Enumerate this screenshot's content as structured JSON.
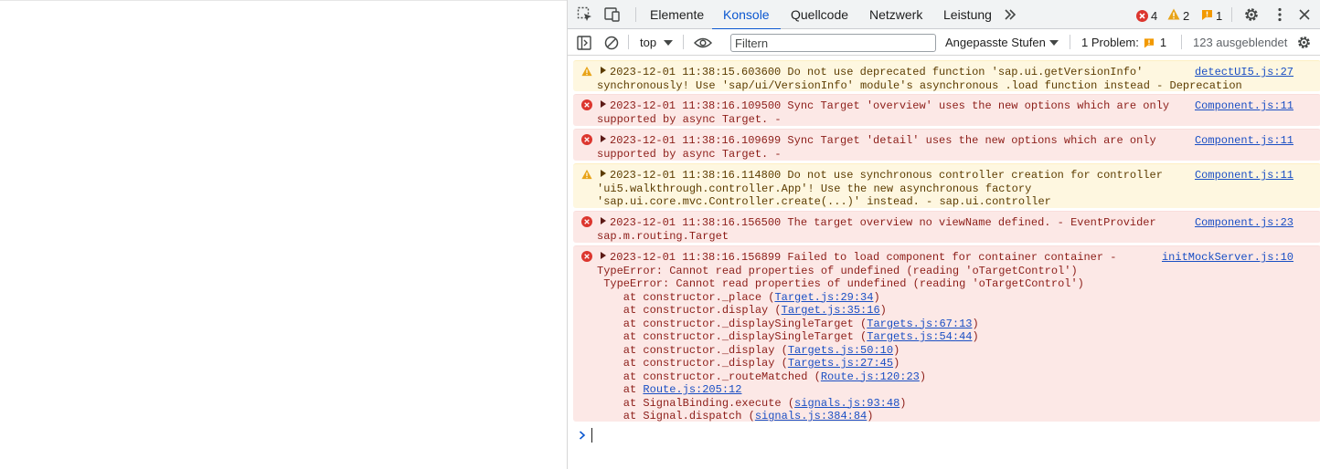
{
  "tabs": [
    {
      "label": "Elemente"
    },
    {
      "label": "Konsole"
    },
    {
      "label": "Quellcode"
    },
    {
      "label": "Netzwerk"
    },
    {
      "label": "Leistung"
    }
  ],
  "counters": {
    "errors": "4",
    "warnings": "2",
    "issues": "1"
  },
  "toolbar": {
    "context": "top",
    "filter_placeholder": "Filtern",
    "levels": "Angepasste Stufen",
    "problems_label": "1 Problem:",
    "problems_count": "1",
    "hidden": "123 ausgeblendet"
  },
  "messages": [
    {
      "level": "warning",
      "source": "detectUI5.js:27",
      "first_line": "2023-12-01 11:38:15.603600 Do not use deprecated function 'sap.ui.getVersionInfo'",
      "lines": [
        "synchronously! Use 'sap/ui/VersionInfo' module's asynchronous .load function instead - Deprecation"
      ]
    },
    {
      "level": "error",
      "source": "Component.js:11",
      "first_line": "2023-12-01 11:38:16.109500 Sync Target 'overview' uses the new options which are only",
      "lines": [
        "supported by async Target. -"
      ]
    },
    {
      "level": "error",
      "source": "Component.js:11",
      "first_line": "2023-12-01 11:38:16.109699 Sync Target 'detail' uses the new options which are only",
      "lines": [
        "supported by async Target. -"
      ]
    },
    {
      "level": "warning",
      "source": "Component.js:11",
      "first_line": "2023-12-01 11:38:16.114800 Do not use synchronous controller creation for controller",
      "lines": [
        "'ui5.walkthrough.controller.App'! Use the new asynchronous factory",
        "'sap.ui.core.mvc.Controller.create(...)' instead. - sap.ui.controller"
      ]
    },
    {
      "level": "error",
      "source": "Component.js:23",
      "first_line": "2023-12-01 11:38:16.156500 The target overview no viewName defined. - EventProvider",
      "lines": [
        "sap.m.routing.Target"
      ]
    },
    {
      "level": "error",
      "source": "initMockServer.js:10",
      "first_line": "2023-12-01 11:38:16.156899 Failed to load component for container container -",
      "lines": [
        "TypeError: Cannot read properties of undefined (reading 'oTargetControl')",
        " TypeError: Cannot read properties of undefined (reading 'oTargetControl')"
      ]
    }
  ],
  "stack": [
    {
      "prefix": "    at constructor._place (",
      "link": "Target.js:29:34",
      "suffix": ")"
    },
    {
      "prefix": "    at constructor.display (",
      "link": "Target.js:35:16",
      "suffix": ")"
    },
    {
      "prefix": "    at constructor._displaySingleTarget (",
      "link": "Targets.js:67:13",
      "suffix": ")"
    },
    {
      "prefix": "    at constructor._displaySingleTarget (",
      "link": "Targets.js:54:44",
      "suffix": ")"
    },
    {
      "prefix": "    at constructor._display (",
      "link": "Targets.js:50:10",
      "suffix": ")"
    },
    {
      "prefix": "    at constructor._display (",
      "link": "Targets.js:27:45",
      "suffix": ")"
    },
    {
      "prefix": "    at constructor._routeMatched (",
      "link": "Route.js:120:23",
      "suffix": ")"
    },
    {
      "prefix": "    at ",
      "link": "Route.js:205:12",
      "suffix": ""
    },
    {
      "prefix": "    at SignalBinding.execute (",
      "link": "signals.js:93:48",
      "suffix": ")"
    },
    {
      "prefix": "    at Signal.dispatch (",
      "link": "signals.js:384:84",
      "suffix": ")"
    }
  ],
  "colors": {
    "accent": "#0b57d0",
    "error": "#dc362e",
    "warning": "#e8a317",
    "issue": "#f29900"
  },
  "icons": [
    "inspect-icon",
    "device-toggle-icon",
    "more-tabs-icon",
    "settings-gear-icon",
    "kebab-menu-icon",
    "close-icon",
    "sidebar-toggle-icon",
    "clear-console-icon",
    "live-expression-eye-icon",
    "chevron-prompt-icon"
  ]
}
